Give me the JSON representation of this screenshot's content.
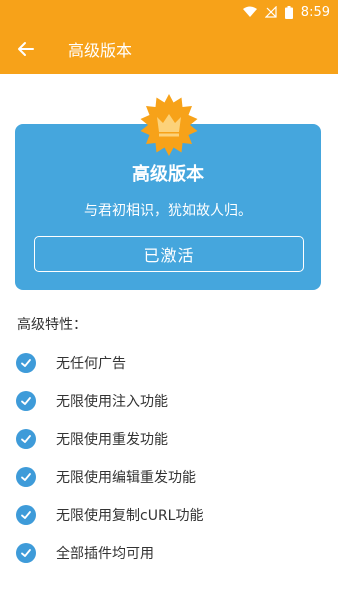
{
  "status_bar": {
    "time": "8:59"
  },
  "app_bar": {
    "title": "高级版本"
  },
  "card": {
    "title": "高级版本",
    "subtitle": "与君初相识，犹如故人归。",
    "button_label": "已激活"
  },
  "features": {
    "heading": "高级特性：",
    "items": [
      "无任何广告",
      "无限使用注入功能",
      "无限使用重发功能",
      "无限使用编辑重发功能",
      "无限使用复制cURL功能",
      "全部插件均可用"
    ]
  },
  "colors": {
    "accent": "#F7A219",
    "card": "#45A6DD",
    "check": "#3E9BD9"
  }
}
